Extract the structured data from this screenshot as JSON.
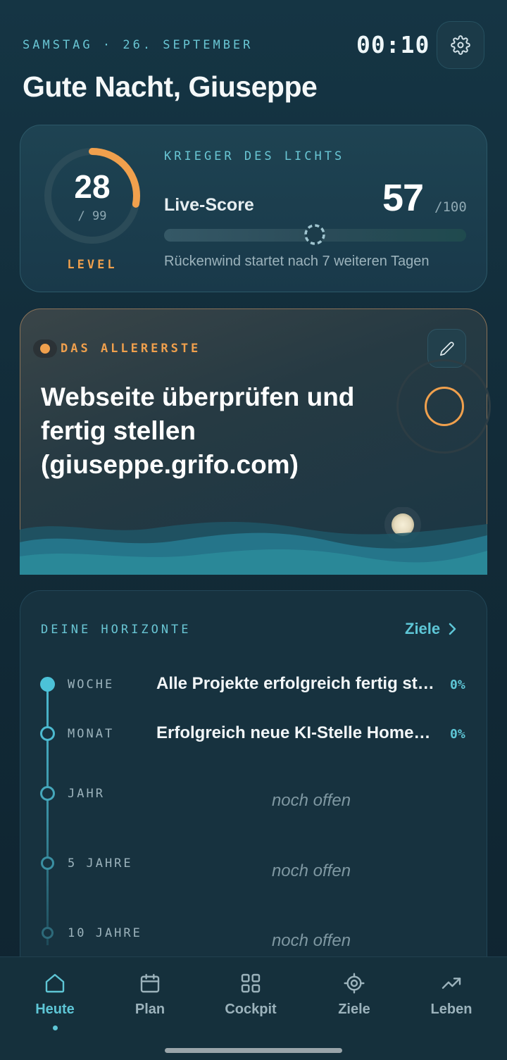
{
  "header": {
    "date": "SAMSTAG · 26. SEPTEMBER",
    "time": "00:10",
    "settings_icon": "gear-icon",
    "greeting": "Gute Nacht, Giuseppe"
  },
  "level": {
    "value": "28",
    "max": "/ 99",
    "label": "LEVEL",
    "progress_fraction": 0.28,
    "rank": "KRIEGER DES LICHTS",
    "live_score_label": "Live-Score",
    "score": "57",
    "score_max": "/100",
    "tailwind_text": "Rückenwind startet nach 7 weiteren Tagen",
    "colors": {
      "accent": "#f0a04d",
      "teal": "#69c6d4"
    }
  },
  "task": {
    "tag": "DAS ALLERERSTE",
    "title": "Webseite überprüfen und fertig stellen (giuseppe.grifo.com)",
    "edit_icon": "pencil-icon"
  },
  "horizons": {
    "title": "DEINE HORIZONTE",
    "link_label": "Ziele",
    "items": [
      {
        "period": "WOCHE",
        "goal": "Alle Projekte erfolgreich fertig stellen",
        "percent": "0%"
      },
      {
        "period": "MONAT",
        "goal": "Erfolgreich neue KI-Stelle Homeoffice",
        "percent": "0%"
      },
      {
        "period": "JAHR",
        "placeholder": "noch offen"
      },
      {
        "period": "5 JAHRE",
        "placeholder": "noch offen"
      },
      {
        "period": "10 JAHRE",
        "placeholder": "noch offen"
      }
    ]
  },
  "nav": {
    "items": [
      {
        "label": "Heute",
        "icon": "home-icon",
        "active": true
      },
      {
        "label": "Plan",
        "icon": "calendar-icon"
      },
      {
        "label": "Cockpit",
        "icon": "grid-icon"
      },
      {
        "label": "Ziele",
        "icon": "target-icon"
      },
      {
        "label": "Leben",
        "icon": "trend-up-icon"
      }
    ]
  }
}
